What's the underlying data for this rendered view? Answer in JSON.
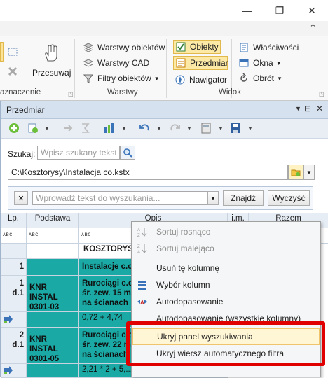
{
  "window": {
    "minimize": "—",
    "restore": "❐",
    "close": "✕"
  },
  "ribbon": {
    "collapse_glyph": "⌃",
    "left_group": {
      "label": "aznaczenie",
      "przesuwaj": "Przesuwaj"
    },
    "warstwy": {
      "items": [
        "Warstwy obiektów",
        "Warstwy CAD",
        "Filtry obiektów"
      ],
      "label": "Warstwy"
    },
    "widok": {
      "items": [
        "Obiekty",
        "Przedmiar",
        "Nawigator"
      ],
      "label": "Widok"
    },
    "right": {
      "items": [
        "Właściwości",
        "Okna",
        "Obrót"
      ]
    }
  },
  "panel": {
    "title": "Przedmiar",
    "search_label": "Szukaj:",
    "search_placeholder": "Wpisz szukany tekst...",
    "path": "C:\\Kosztorysy\\Instalacja co.kstx",
    "filter_placeholder": "Wprowadź tekst do wyszukania...",
    "find_button": "Znajdź",
    "clear_button": "Wyczyść"
  },
  "grid": {
    "headers": [
      "Lp.",
      "Podstawa",
      "Opis",
      "j.m.",
      "Razem"
    ],
    "filter_glyph": "ᴀʙc",
    "kosztorys_label": "KOSZTORYS:",
    "rows": [
      {
        "lp": "1",
        "podstawa": "",
        "opis": "Instalacje c.o."
      },
      {
        "lp1": "1",
        "lp2": "d.1",
        "podstawa1": "KNR INSTAL",
        "podstawa2": "0301-03",
        "opis1": "Rurociągi c.o.",
        "opis2": "śr. zew. 15 m",
        "opis3": "na ścianach"
      },
      {
        "opis": "0,72 + 4,74"
      },
      {
        "lp1": "2",
        "lp2": "d.1",
        "podstawa1": "KNR INSTAL",
        "podstawa2": "0301-05",
        "opis1": "Rurociągi c.o.",
        "opis2": "śr. zew. 22 m",
        "opis3": "na ścianach"
      },
      {
        "opis": "2,21 * 2 + 5,..."
      }
    ]
  },
  "context_menu": {
    "items": [
      {
        "label": "Sortuj rosnąco",
        "disabled": true
      },
      {
        "label": "Sortuj malejąco",
        "disabled": true
      },
      {
        "label": "Usuń tę kolumnę",
        "disabled": false
      },
      {
        "label": "Wybór kolumn",
        "disabled": false
      },
      {
        "label": "Autodopasowanie",
        "disabled": false
      },
      {
        "label": "Autodopasowanie (wszystkie kolumny)",
        "disabled": false
      },
      {
        "label": "Ukryj panel wyszukiwania",
        "disabled": false,
        "highlighted": true
      },
      {
        "label": "Ukryj wiersz automatycznego filtra",
        "disabled": false
      }
    ]
  },
  "colors": {
    "teal": "#1aa9a4",
    "highlight_box": "#e00000",
    "selected_ribbon": "#fde9a6"
  }
}
